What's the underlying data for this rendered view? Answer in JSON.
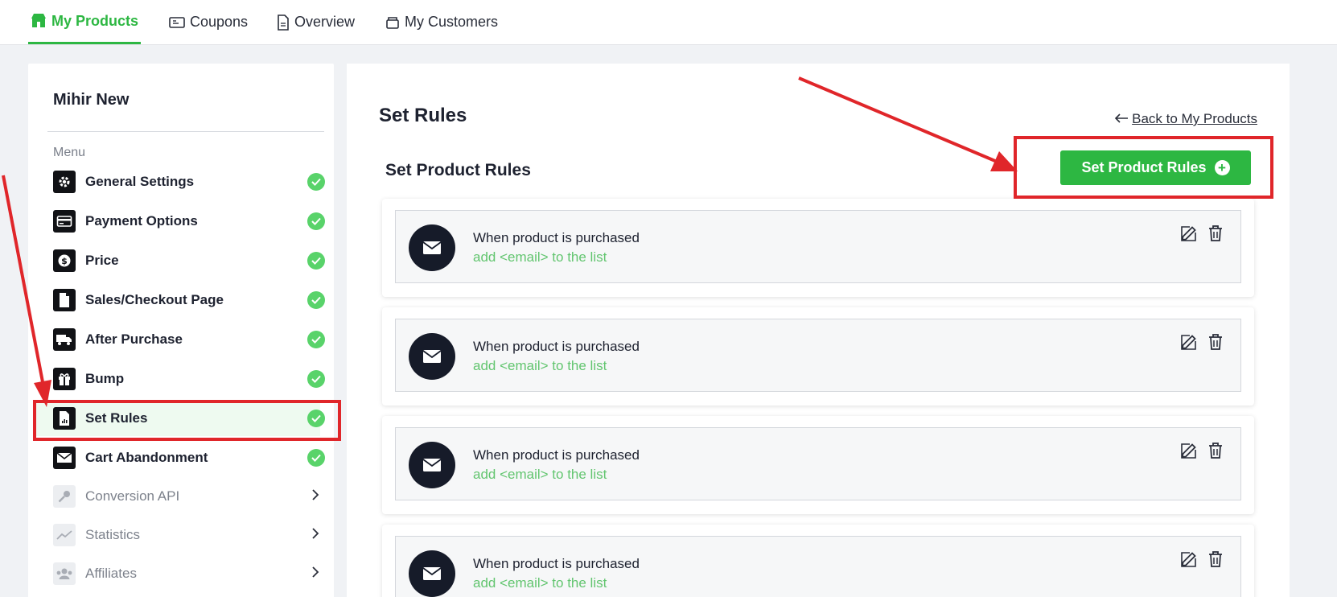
{
  "nav": {
    "tabs": [
      {
        "label": "My Products",
        "icon": "store-icon",
        "active": true
      },
      {
        "label": "Coupons",
        "icon": "ticket-icon",
        "active": false
      },
      {
        "label": "Overview",
        "icon": "document-icon",
        "active": false
      },
      {
        "label": "My Customers",
        "icon": "customers-icon",
        "active": false
      }
    ]
  },
  "sidebar": {
    "product_name": "Mihir New",
    "menu_label": "Menu",
    "items": [
      {
        "label": "General Settings",
        "icon": "gear-icon",
        "status": "complete"
      },
      {
        "label": "Payment Options",
        "icon": "credit-card-icon",
        "status": "complete"
      },
      {
        "label": "Price",
        "icon": "dollar-icon",
        "status": "complete"
      },
      {
        "label": "Sales/Checkout Page",
        "icon": "page-icon",
        "status": "complete"
      },
      {
        "label": "After Purchase",
        "icon": "truck-icon",
        "status": "complete"
      },
      {
        "label": "Bump",
        "icon": "gift-icon",
        "status": "complete"
      },
      {
        "label": "Set Rules",
        "icon": "report-icon",
        "status": "complete",
        "active": true
      },
      {
        "label": "Cart Abandonment",
        "icon": "envelope-icon",
        "status": "complete"
      },
      {
        "label": "Conversion API",
        "icon": "key-icon",
        "status": "locked"
      },
      {
        "label": "Statistics",
        "icon": "trend-icon",
        "status": "locked"
      },
      {
        "label": "Affiliates",
        "icon": "users-icon",
        "status": "locked"
      }
    ]
  },
  "main": {
    "title": "Set Rules",
    "back_link": "Back to My Products",
    "section_title": "Set Product Rules",
    "add_button": "Set Product Rules",
    "rules": [
      {
        "trigger": "When product is purchased",
        "action": "add <email> to the list",
        "icon": "envelope-icon"
      },
      {
        "trigger": "When product is purchased",
        "action": "add <email> to the list",
        "icon": "envelope-icon"
      },
      {
        "trigger": "When product is purchased",
        "action": "add <email> to the list",
        "icon": "envelope-icon"
      },
      {
        "trigger": "When product is purchased",
        "action": "add <email> to the list",
        "icon": "envelope-icon"
      }
    ]
  },
  "colors": {
    "accent_green": "#2db742",
    "status_green": "#59d36a",
    "action_text_green": "#62c56f",
    "annotation_red": "#e0262a",
    "dark_icon": "#161b29"
  }
}
